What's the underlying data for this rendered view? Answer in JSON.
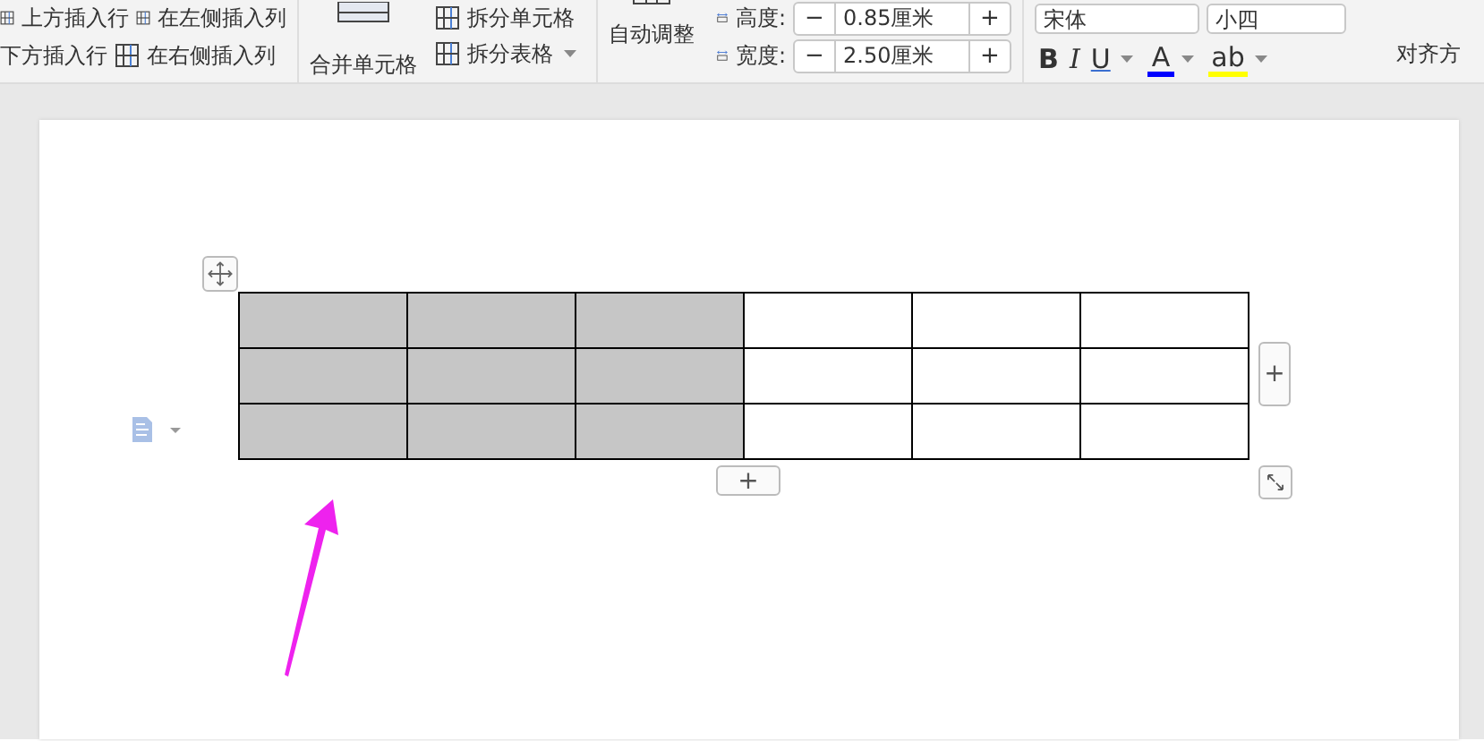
{
  "ribbon": {
    "insert": {
      "above": "上方插入行",
      "left": "在左侧插入列",
      "below": "下方插入行",
      "right": "在右侧插入列"
    },
    "merge": {
      "label": "合并单元格",
      "split_cells": "拆分单元格",
      "split_table": "拆分表格"
    },
    "autofit": {
      "label": "自动调整"
    },
    "size": [
      {
        "kind": "height",
        "label": "高度:",
        "value": "0.85厘米",
        "minus": "−",
        "plus": "+"
      },
      {
        "kind": "width",
        "label": "宽度:",
        "value": "2.50厘米",
        "minus": "−",
        "plus": "+"
      }
    ],
    "font": {
      "name": "宋体",
      "size": "小四"
    },
    "format_buttons": [
      {
        "kind": "bold",
        "label": "B"
      },
      {
        "kind": "italic",
        "label": "I"
      },
      {
        "kind": "underline",
        "label": "U"
      },
      {
        "kind": "font_color",
        "label": "A",
        "color": "#0000ff"
      },
      {
        "kind": "highlight",
        "label": "ab",
        "color": "#ffff00"
      }
    ],
    "align": {
      "label": "对齐方"
    }
  },
  "table": {
    "rows": [
      [
        {
          "selected": true
        },
        {
          "selected": true
        },
        {
          "selected": true
        },
        {
          "selected": false
        },
        {
          "selected": false
        },
        {
          "selected": false
        }
      ],
      [
        {
          "selected": true
        },
        {
          "selected": true
        },
        {
          "selected": true
        },
        {
          "selected": false
        },
        {
          "selected": false
        },
        {
          "selected": false
        }
      ],
      [
        {
          "selected": true
        },
        {
          "selected": true
        },
        {
          "selected": true
        },
        {
          "selected": false
        },
        {
          "selected": false
        },
        {
          "selected": false
        }
      ]
    ],
    "add_column_button": "+",
    "add_row_button": "+"
  }
}
